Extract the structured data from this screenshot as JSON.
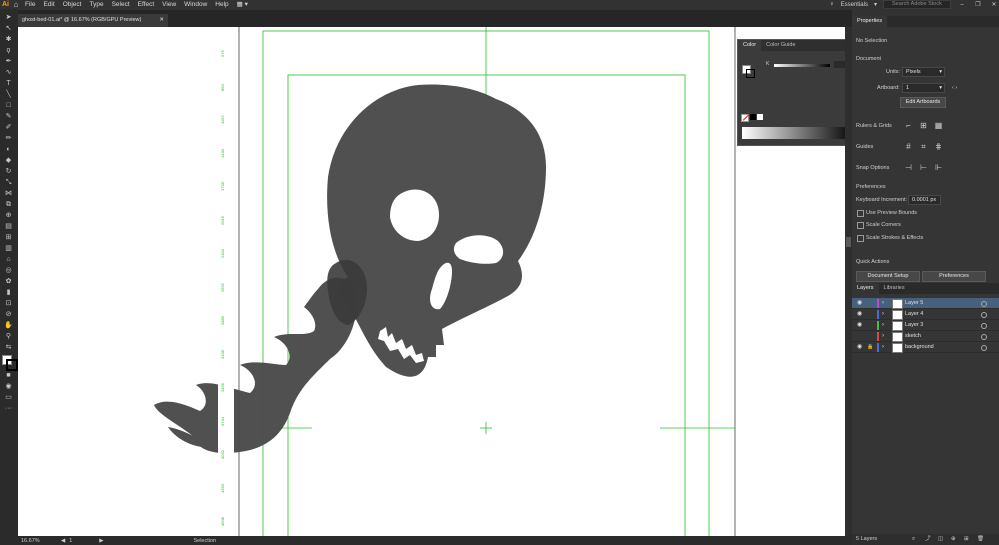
{
  "app": {
    "logo": "Ai"
  },
  "menubar": {
    "items": [
      "File",
      "Edit",
      "Object",
      "Type",
      "Select",
      "Effect",
      "View",
      "Window",
      "Help"
    ],
    "workspace": "Essentials",
    "search_placeholder": "Search Adobe Stock"
  },
  "document": {
    "tab_title": "ghost-bed-01.ai* @ 16.67% (RGB/GPU Preview)"
  },
  "ruler_ticks": [
    "576",
    "864",
    "1152",
    "1440",
    "1728",
    "2016",
    "2304",
    "2592",
    "2880",
    "3168",
    "3456",
    "3744",
    "4032",
    "4320",
    "4608"
  ],
  "status": {
    "zoom": "16.67%",
    "artboard_num": "1",
    "mode": "Selection"
  },
  "color_panel": {
    "tabs": [
      "Color",
      "Color Guide"
    ],
    "k_label": "K",
    "k_value": "0",
    "pct": "%"
  },
  "properties": {
    "tab": "Properties",
    "no_selection": "No Selection",
    "document_header": "Document",
    "units_label": "Units:",
    "units_value": "Pixels",
    "artboard_label": "Artboard:",
    "artboard_value": "1",
    "edit_artboards": "Edit Artboards",
    "rulers_grids": "Rulers & Grids",
    "guides": "Guides",
    "snap_options": "Snap Options",
    "preferences_header": "Preferences",
    "keyboard_increment_label": "Keyboard Increment:",
    "keyboard_increment_value": "0.0001 px",
    "use_preview_bounds": "Use Preview Bounds",
    "scale_corners": "Scale Corners",
    "scale_strokes": "Scale Strokes & Effects",
    "quick_actions": "Quick Actions",
    "document_setup": "Document Setup",
    "preferences_btn": "Preferences"
  },
  "layers": {
    "tabs": [
      "Layers",
      "Libraries"
    ],
    "rows": [
      {
        "name": "Layer 5",
        "color": "#b84ad6",
        "selected": true,
        "locked": false,
        "visible": true
      },
      {
        "name": "Layer 4",
        "color": "#4a6cd6",
        "selected": false,
        "locked": false,
        "visible": true
      },
      {
        "name": "Layer 3",
        "color": "#3fbf3f",
        "selected": false,
        "locked": false,
        "visible": true
      },
      {
        "name": "sketch",
        "color": "#d64a4a",
        "selected": false,
        "locked": false,
        "visible": false
      },
      {
        "name": "background",
        "color": "#4a6cd6",
        "selected": false,
        "locked": true,
        "visible": true
      }
    ],
    "footer": "5 Layers"
  },
  "colors": {
    "guide": "#27c227",
    "shape": "#4a4a4a",
    "selection": "#46607e"
  }
}
